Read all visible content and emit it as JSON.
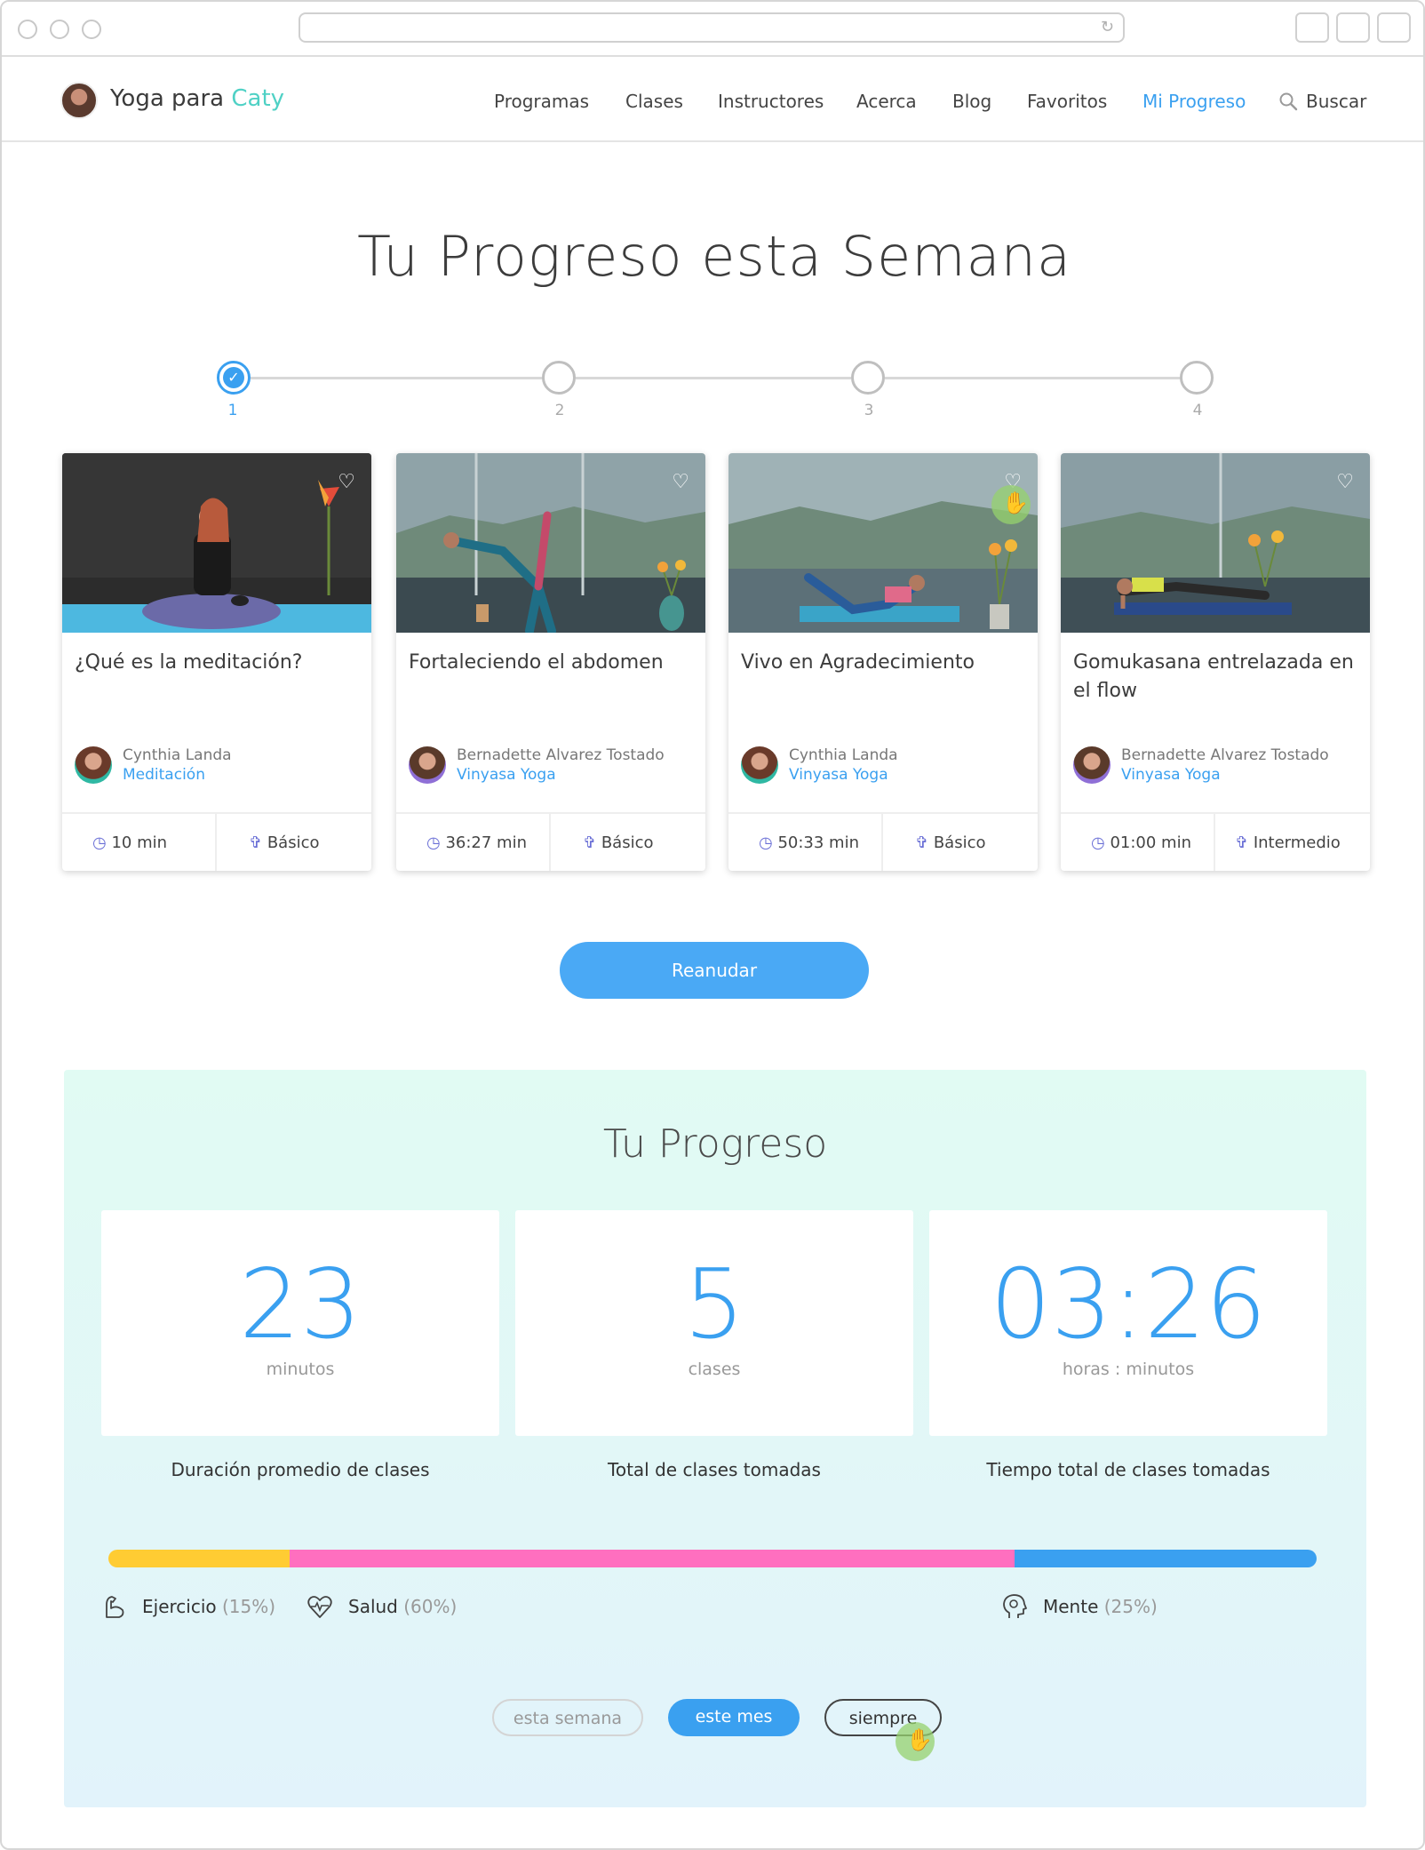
{
  "nav": {
    "brand_prefix": "Yoga para ",
    "brand_accent": "Caty",
    "items": [
      "Programas",
      "Clases",
      "Instructores",
      "Acerca",
      "Blog",
      "Favoritos",
      "Mi Progreso"
    ],
    "active_item": "Mi Progreso",
    "search_label": "Buscar"
  },
  "page_title": "Tu Progreso esta Semana",
  "stepper": {
    "steps": [
      "1",
      "2",
      "3",
      "4"
    ],
    "completed": 1
  },
  "cards": [
    {
      "title": "¿Qué es la meditación?",
      "instructor": "Cynthia Landa",
      "category": "Meditación",
      "duration": "10 min",
      "level": "Básico"
    },
    {
      "title": "Fortaleciendo el abdomen",
      "instructor": "Bernadette Alvarez Tostado",
      "category": "Vinyasa Yoga",
      "duration": "36:27 min",
      "level": "Básico"
    },
    {
      "title": "Vivo en Agradecimiento",
      "instructor": "Cynthia Landa",
      "category": "Vinyasa Yoga",
      "duration": "50:33 min",
      "level": "Básico"
    },
    {
      "title": "Gomukasana entrelazada en el flow",
      "instructor": "Bernadette Alvarez Tostado",
      "category": "Vinyasa Yoga",
      "duration": "01:00 min",
      "level": "Intermedio"
    }
  ],
  "resume_label": "Reanudar",
  "progress": {
    "title": "Tu Progreso",
    "stats": [
      {
        "value": "23",
        "unit": "minutos",
        "label": "Duración promedio de clases"
      },
      {
        "value": "5",
        "unit": "clases",
        "label": "Total de clases tomadas"
      },
      {
        "value": "03:26",
        "unit": "horas : minutos",
        "label": "Tiempo total de clases tomadas"
      }
    ],
    "breakdown": [
      {
        "name": "Ejercicio",
        "pct_text": "(15%)",
        "share": 0.15,
        "color": "#ffcc33"
      },
      {
        "name": "Salud",
        "pct_text": "(60%)",
        "share": 0.6,
        "color": "#ff6fbf"
      },
      {
        "name": "Mente",
        "pct_text": "(25%)",
        "share": 0.25,
        "color": "#3aa0f0"
      }
    ],
    "filters": [
      "esta semana",
      "este mes",
      "siempre"
    ],
    "active_filter": "este mes"
  },
  "colors": {
    "accent": "#3aa0f0",
    "brand_accent": "#4fd1c5",
    "level_icon": "#6a6fd6"
  }
}
